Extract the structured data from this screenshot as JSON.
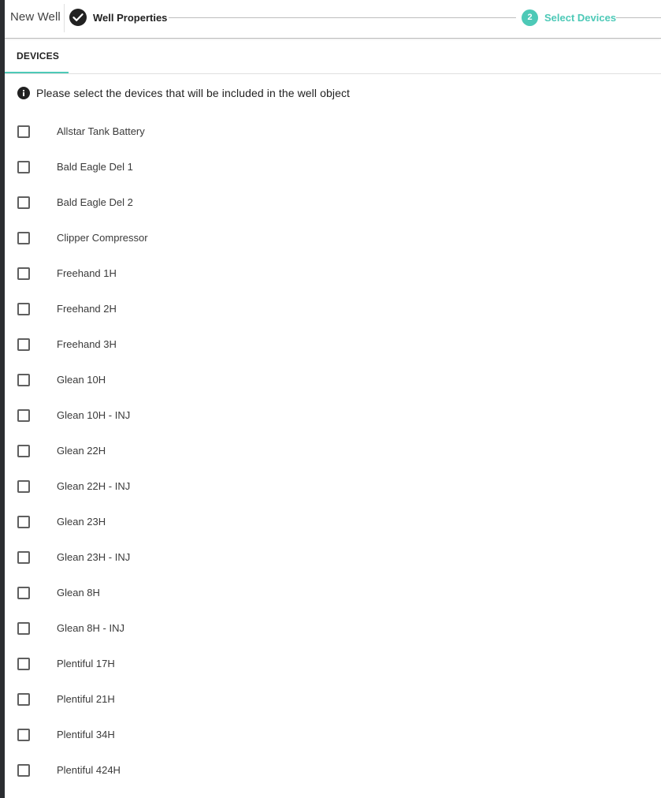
{
  "header": {
    "title": "New Well",
    "steps": [
      {
        "label": "Well Properties",
        "state": "completed",
        "icon": "check-icon"
      },
      {
        "number": "2",
        "label": "Select Devices",
        "state": "active"
      }
    ]
  },
  "tabs": [
    {
      "label": "DEVICES",
      "active": true
    }
  ],
  "info": {
    "icon": "info-icon",
    "text": "Please select the devices that will be included in the well object"
  },
  "devices": [
    {
      "label": "Allstar Tank Battery",
      "checked": false
    },
    {
      "label": "Bald Eagle Del 1",
      "checked": false
    },
    {
      "label": "Bald Eagle Del 2",
      "checked": false
    },
    {
      "label": "Clipper Compressor",
      "checked": false
    },
    {
      "label": "Freehand 1H",
      "checked": false
    },
    {
      "label": "Freehand 2H",
      "checked": false
    },
    {
      "label": "Freehand 3H",
      "checked": false
    },
    {
      "label": "Glean 10H",
      "checked": false
    },
    {
      "label": "Glean 10H - INJ",
      "checked": false
    },
    {
      "label": "Glean 22H",
      "checked": false
    },
    {
      "label": "Glean 22H - INJ",
      "checked": false
    },
    {
      "label": "Glean 23H",
      "checked": false
    },
    {
      "label": "Glean 23H - INJ",
      "checked": false
    },
    {
      "label": "Glean 8H",
      "checked": false
    },
    {
      "label": "Glean 8H - INJ",
      "checked": false
    },
    {
      "label": "Plentiful 17H",
      "checked": false
    },
    {
      "label": "Plentiful 21H",
      "checked": false
    },
    {
      "label": "Plentiful 34H",
      "checked": false
    },
    {
      "label": "Plentiful 424H",
      "checked": false
    }
  ],
  "colors": {
    "accent": "#4dc9b7",
    "text": "#212121",
    "completed_step": "#212121",
    "divider": "#bdbdbd"
  }
}
